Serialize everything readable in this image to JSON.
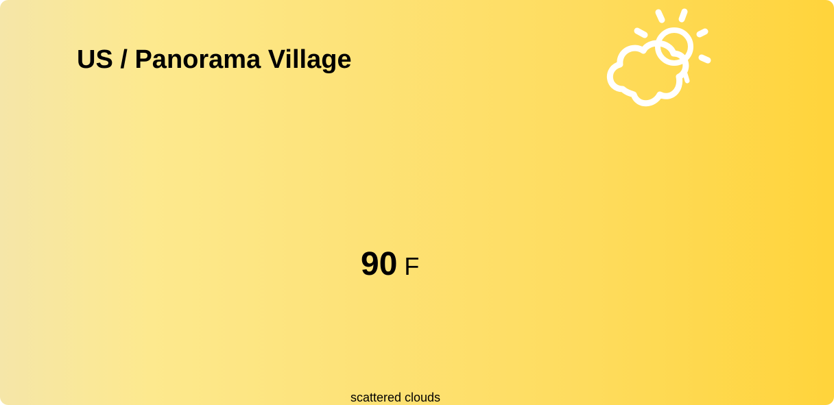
{
  "weather": {
    "location": "US / Panorama Village",
    "temperature": "90",
    "unit": "F",
    "description": "scattered clouds",
    "icon": "partly-cloudy-icon"
  },
  "colors": {
    "gradient_start": "#f5e6a8",
    "gradient_end": "#ffd43b",
    "icon_stroke": "#ffffff",
    "text": "#000000"
  }
}
